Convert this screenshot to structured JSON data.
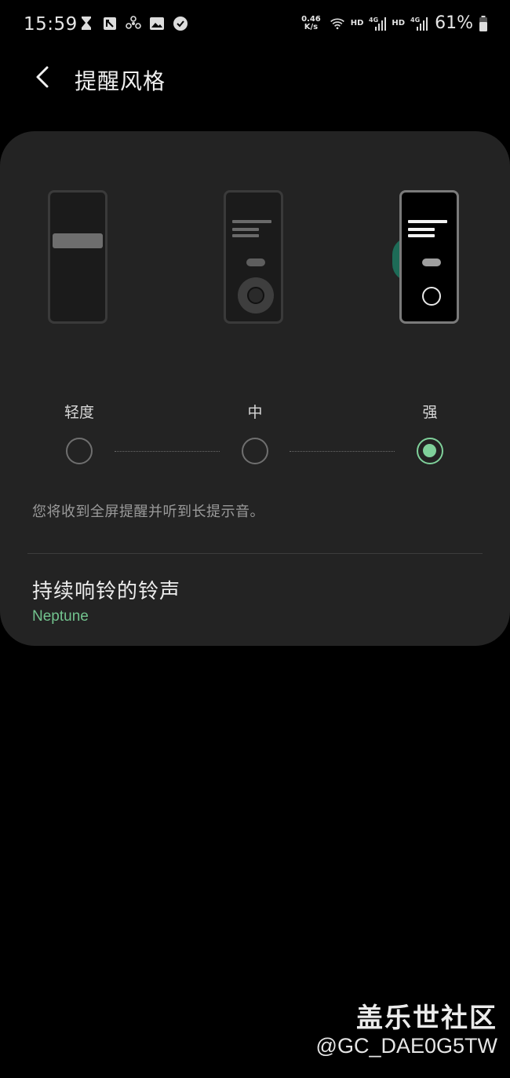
{
  "status_bar": {
    "time": "15:59",
    "left_icons": [
      "hourglass-icon",
      "nfc-icon",
      "fan-icon",
      "image-icon",
      "check-badge-icon"
    ],
    "net_speed_value": "0.46",
    "net_speed_unit": "K/s",
    "hd_label_1": "HD",
    "network_1": "4G",
    "hd_label_2": "HD",
    "network_2": "4G",
    "battery": "61%"
  },
  "header": {
    "back_icon": "chevron-left-icon",
    "title": "提醒风格"
  },
  "style_selector": {
    "levels": [
      {
        "label": "轻度",
        "selected": false
      },
      {
        "label": "中",
        "selected": false
      },
      {
        "label": "强",
        "selected": true
      }
    ],
    "description": "您将收到全屏提醒并听到长提示音。"
  },
  "ringtone": {
    "title": "持续响铃的铃声",
    "value": "Neptune"
  },
  "watermark": {
    "site": "盖乐世社区",
    "user": "@GC_DAE0G5TW"
  },
  "colors": {
    "accent": "#7fd09a",
    "card": "#232323",
    "background": "#000000"
  }
}
